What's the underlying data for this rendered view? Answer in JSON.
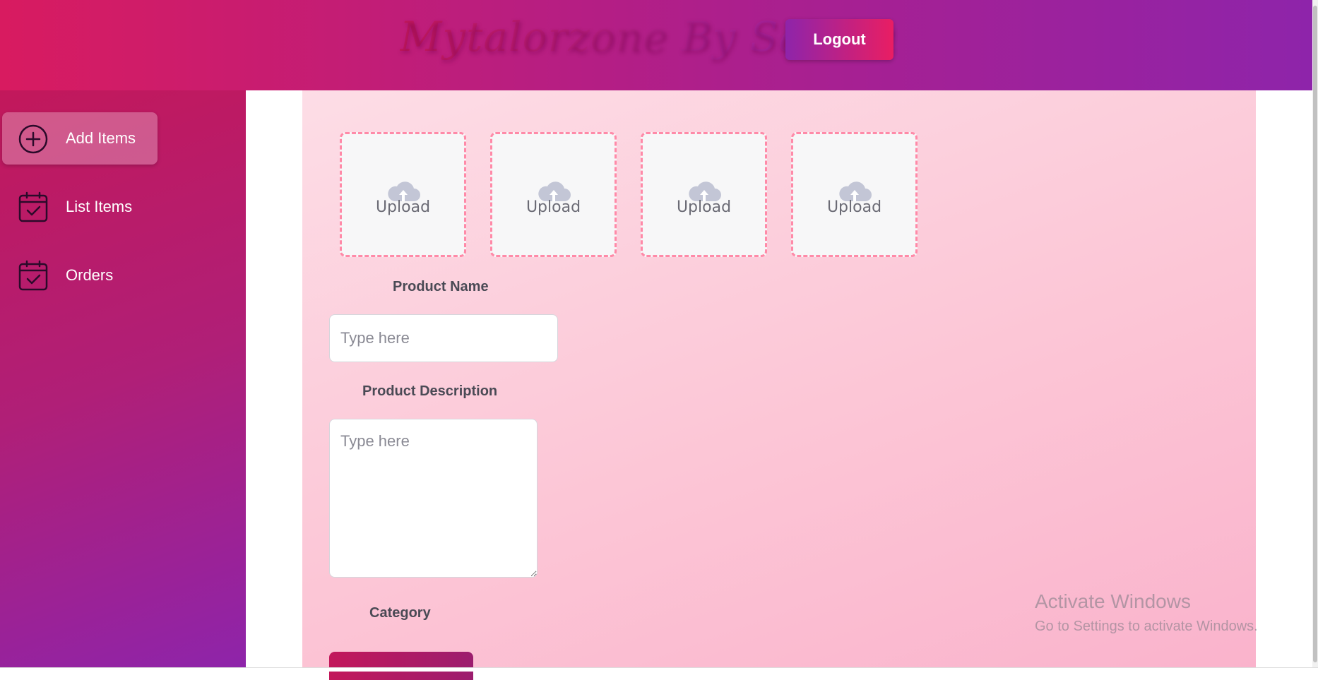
{
  "header": {
    "brand": "Mytalorzone By Sahiba",
    "logout_label": "Logout"
  },
  "sidebar": {
    "items": [
      {
        "label": "Add Items",
        "icon": "plus-circle-icon",
        "active": true
      },
      {
        "label": "List Items",
        "icon": "calendar-check-icon",
        "active": false
      },
      {
        "label": "Orders",
        "icon": "calendar-check-icon",
        "active": false
      }
    ]
  },
  "form": {
    "uploads": [
      {
        "label": "Upload",
        "icon": "cloud-upload-icon"
      },
      {
        "label": "Upload",
        "icon": "cloud-upload-icon"
      },
      {
        "label": "Upload",
        "icon": "cloud-upload-icon"
      },
      {
        "label": "Upload",
        "icon": "cloud-upload-icon"
      }
    ],
    "product_name": {
      "label": "Product Name",
      "placeholder": "Type here",
      "value": ""
    },
    "product_description": {
      "label": "Product Description",
      "placeholder": "Type here",
      "value": ""
    },
    "category": {
      "label": "Category"
    }
  },
  "watermark": {
    "title": "Activate Windows",
    "subtitle": "Go to Settings to activate Windows."
  },
  "colors": {
    "brand_pink": "#d81b60",
    "brand_purple": "#8e24aa",
    "upload_border": "#ff8aa8"
  }
}
